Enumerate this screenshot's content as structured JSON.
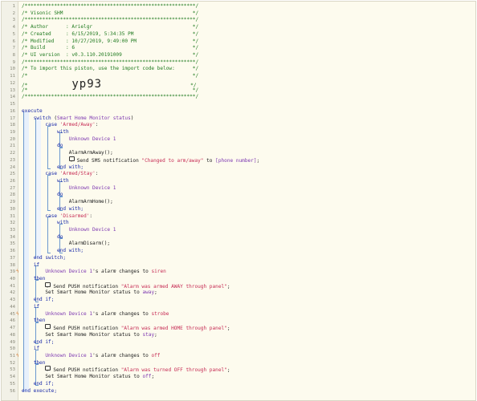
{
  "lines": [
    {
      "n": "1",
      "text": "/**********************************************************/"
    },
    {
      "n": "2",
      "text": "/* Visonic SHM                                            */"
    },
    {
      "n": "3",
      "text": "/**********************************************************/"
    },
    {
      "n": "4",
      "text": "/* Author      : Arielgr                                  */"
    },
    {
      "n": "5",
      "text": "/* Created     : 6/15/2019, 5:34:35 PM                    */"
    },
    {
      "n": "6",
      "text": "/* Modified    : 10/27/2019, 9:49:00 PM                   */"
    },
    {
      "n": "7",
      "text": "/* Build       : 6                                        */"
    },
    {
      "n": "8",
      "text": "/* UI version  : v0.3.110.20191009                        */"
    },
    {
      "n": "9",
      "text": "/**********************************************************/"
    },
    {
      "n": "10",
      "text": "/* To import this piston, use the import code below:      */"
    },
    {
      "n": "11",
      "text": "/*                                                        */"
    },
    {
      "n": "12",
      "pre": "/*               ",
      "big": "yp93",
      "post": "                              */"
    },
    {
      "n": "13",
      "text": "/*                                                        */"
    },
    {
      "n": "14",
      "text": "/**********************************************************/"
    },
    {
      "n": "15",
      "text": ""
    },
    {
      "n": "16",
      "kw": "execute"
    },
    {
      "n": "17",
      "indent": "    ",
      "kw": "switch",
      "p1": " (",
      "dev": "Smart Home Monitor status",
      "p2": ")"
    },
    {
      "n": "18",
      "indent": "        ",
      "kw": "case",
      "p1": " ",
      "str": "'Armed/Away'",
      "p2": ":"
    },
    {
      "n": "19",
      "indent": "            ",
      "kw": "with"
    },
    {
      "n": "20",
      "indent": "                ",
      "dev": "Unknown Device 1"
    },
    {
      "n": "21",
      "indent": "            ",
      "kw": "do"
    },
    {
      "n": "22",
      "indent": "                ",
      "plain": "AlarmArmAway();"
    },
    {
      "n": "23",
      "indent": "                ",
      "bubble": true,
      "plain": "Send SMS notification ",
      "str": "\"Changed to arm/away\"",
      "p2": " to ",
      "dev": "[phone number]",
      "p3": ";"
    },
    {
      "n": "24",
      "indent": "            ",
      "kw": "end with;"
    },
    {
      "n": "25",
      "indent": "        ",
      "kw": "case",
      "p1": " ",
      "str": "'Armed/Stay'",
      "p2": ":"
    },
    {
      "n": "26",
      "indent": "            ",
      "kw": "with"
    },
    {
      "n": "27",
      "indent": "                ",
      "dev": "Unknown Device 1"
    },
    {
      "n": "28",
      "indent": "            ",
      "kw": "do"
    },
    {
      "n": "29",
      "indent": "                ",
      "plain": "AlarmArmHome();"
    },
    {
      "n": "30",
      "indent": "            ",
      "kw": "end with;"
    },
    {
      "n": "31",
      "indent": "        ",
      "kw": "case",
      "p1": " ",
      "str": "'Disarmed'",
      "p2": ":"
    },
    {
      "n": "32",
      "indent": "            ",
      "kw": "with"
    },
    {
      "n": "33",
      "indent": "                ",
      "dev": "Unknown Device 1"
    },
    {
      "n": "34",
      "indent": "            ",
      "kw": "do"
    },
    {
      "n": "35",
      "indent": "                ",
      "plain": "AlarmDisarm();"
    },
    {
      "n": "36",
      "indent": "            ",
      "kw": "end with;"
    },
    {
      "n": "37",
      "indent": "    ",
      "kw": "end switch;"
    },
    {
      "n": "38",
      "indent": "    ",
      "kw": "if"
    },
    {
      "n": "39",
      "flag": "ϟ",
      "indent": "        ",
      "dev": "Unknown Device 1",
      "p1": "'s ",
      "it": "alarm",
      "p2": " changes to ",
      "str": "siren"
    },
    {
      "n": "40",
      "indent": "    ",
      "kw": "then"
    },
    {
      "n": "41",
      "indent": "        ",
      "bubble": true,
      "plain": "Send PUSH notification ",
      "str": "\"Alarm was armed AWAY through panel\"",
      "p3": ";"
    },
    {
      "n": "42",
      "indent": "        ",
      "plain": "Set Smart Home Monitor status to ",
      "dev": "away",
      "p3": ";"
    },
    {
      "n": "43",
      "indent": "    ",
      "kw": "end if;"
    },
    {
      "n": "44",
      "indent": "    ",
      "kw": "if"
    },
    {
      "n": "45",
      "flag": "ϟ",
      "indent": "        ",
      "dev": "Unknown Device 1",
      "p1": "'s ",
      "it": "alarm",
      "p2": " changes to ",
      "str": "strobe"
    },
    {
      "n": "46",
      "indent": "    ",
      "kw": "then"
    },
    {
      "n": "47",
      "indent": "        ",
      "bubble": true,
      "plain": "Send PUSH notification ",
      "str": "\"Alarm was armed HOME through panel\"",
      "p3": ";"
    },
    {
      "n": "48",
      "indent": "        ",
      "plain": "Set Smart Home Monitor status to ",
      "dev": "stay",
      "p3": ";"
    },
    {
      "n": "49",
      "indent": "    ",
      "kw": "end if;"
    },
    {
      "n": "50",
      "indent": "    ",
      "kw": "if"
    },
    {
      "n": "51",
      "flag": "ϟ",
      "indent": "        ",
      "dev": "Unknown Device 1",
      "p1": "'s ",
      "it": "alarm",
      "p2": " changes to ",
      "str": "off"
    },
    {
      "n": "52",
      "indent": "    ",
      "kw": "then"
    },
    {
      "n": "53",
      "indent": "        ",
      "bubble": true,
      "plain": "Send PUSH notification ",
      "str": "\"Alarm was turned OFF through panel\"",
      "p3": ";"
    },
    {
      "n": "54",
      "indent": "        ",
      "plain": "Set Smart Home Monitor status to ",
      "dev": "off",
      "p3": ";"
    },
    {
      "n": "55",
      "indent": "    ",
      "kw": "end if;"
    },
    {
      "n": "56",
      "kw": "end execute;"
    }
  ],
  "colors": {
    "comment": "#1f7a1f",
    "keyword": "#1a2aa8",
    "string": "#c62b54",
    "device": "#7c36b0",
    "guide": "#6b98cf",
    "background": "#fdfbee",
    "flag": "#d97a2e"
  },
  "icons": {
    "flag": "trigger-lightning-icon",
    "bubble": "notification-bubble-icon"
  }
}
